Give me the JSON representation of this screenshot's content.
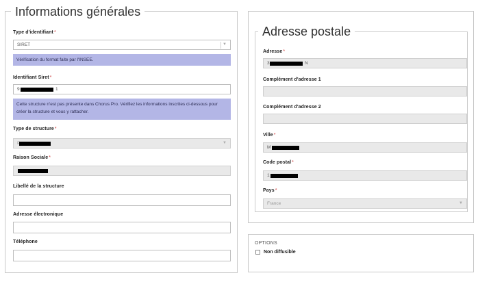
{
  "general": {
    "title": "Informations générales",
    "identifier_type": {
      "label": "Type d'identifiant",
      "value": "SIRET"
    },
    "insee_notice": "Vérification du format faite par l'INSEE.",
    "siret": {
      "label": "Identifiant Siret",
      "prefix": "9",
      "suffix": "1"
    },
    "chorus_notice": "Cette structure n'est pas présente dans Chorus Pro. Vérifiez les informations inscrites ci-dessous pour créer la structure et vous y rattacher.",
    "structure_type": {
      "label": "Type de structure",
      "prefix": "P"
    },
    "social_reason": {
      "label": "Raison Sociale"
    },
    "structure_label": {
      "label": "Libellé de la structure",
      "value": ""
    },
    "email": {
      "label": "Adresse électronique",
      "value": ""
    },
    "phone": {
      "label": "Téléphone",
      "value": ""
    },
    "required_mark": "*"
  },
  "postal": {
    "title": "Adresse postale",
    "address": {
      "label": "Adresse",
      "prefix": "3",
      "suffix": "N"
    },
    "complement1": {
      "label": "Complément d'adresse 1",
      "value": ""
    },
    "complement2": {
      "label": "Complément d'adresse 2",
      "value": ""
    },
    "city": {
      "label": "Ville",
      "prefix": "M"
    },
    "postal_code": {
      "label": "Code postal",
      "prefix": "1"
    },
    "country": {
      "label": "Pays",
      "value": "France"
    }
  },
  "options": {
    "title": "OPTIONS",
    "non_diffusible": "Non diffusible"
  },
  "colors": {
    "info_bg": "#b3b6e6",
    "required": "#cc3333",
    "disabled_bg": "#e9e9e9"
  }
}
